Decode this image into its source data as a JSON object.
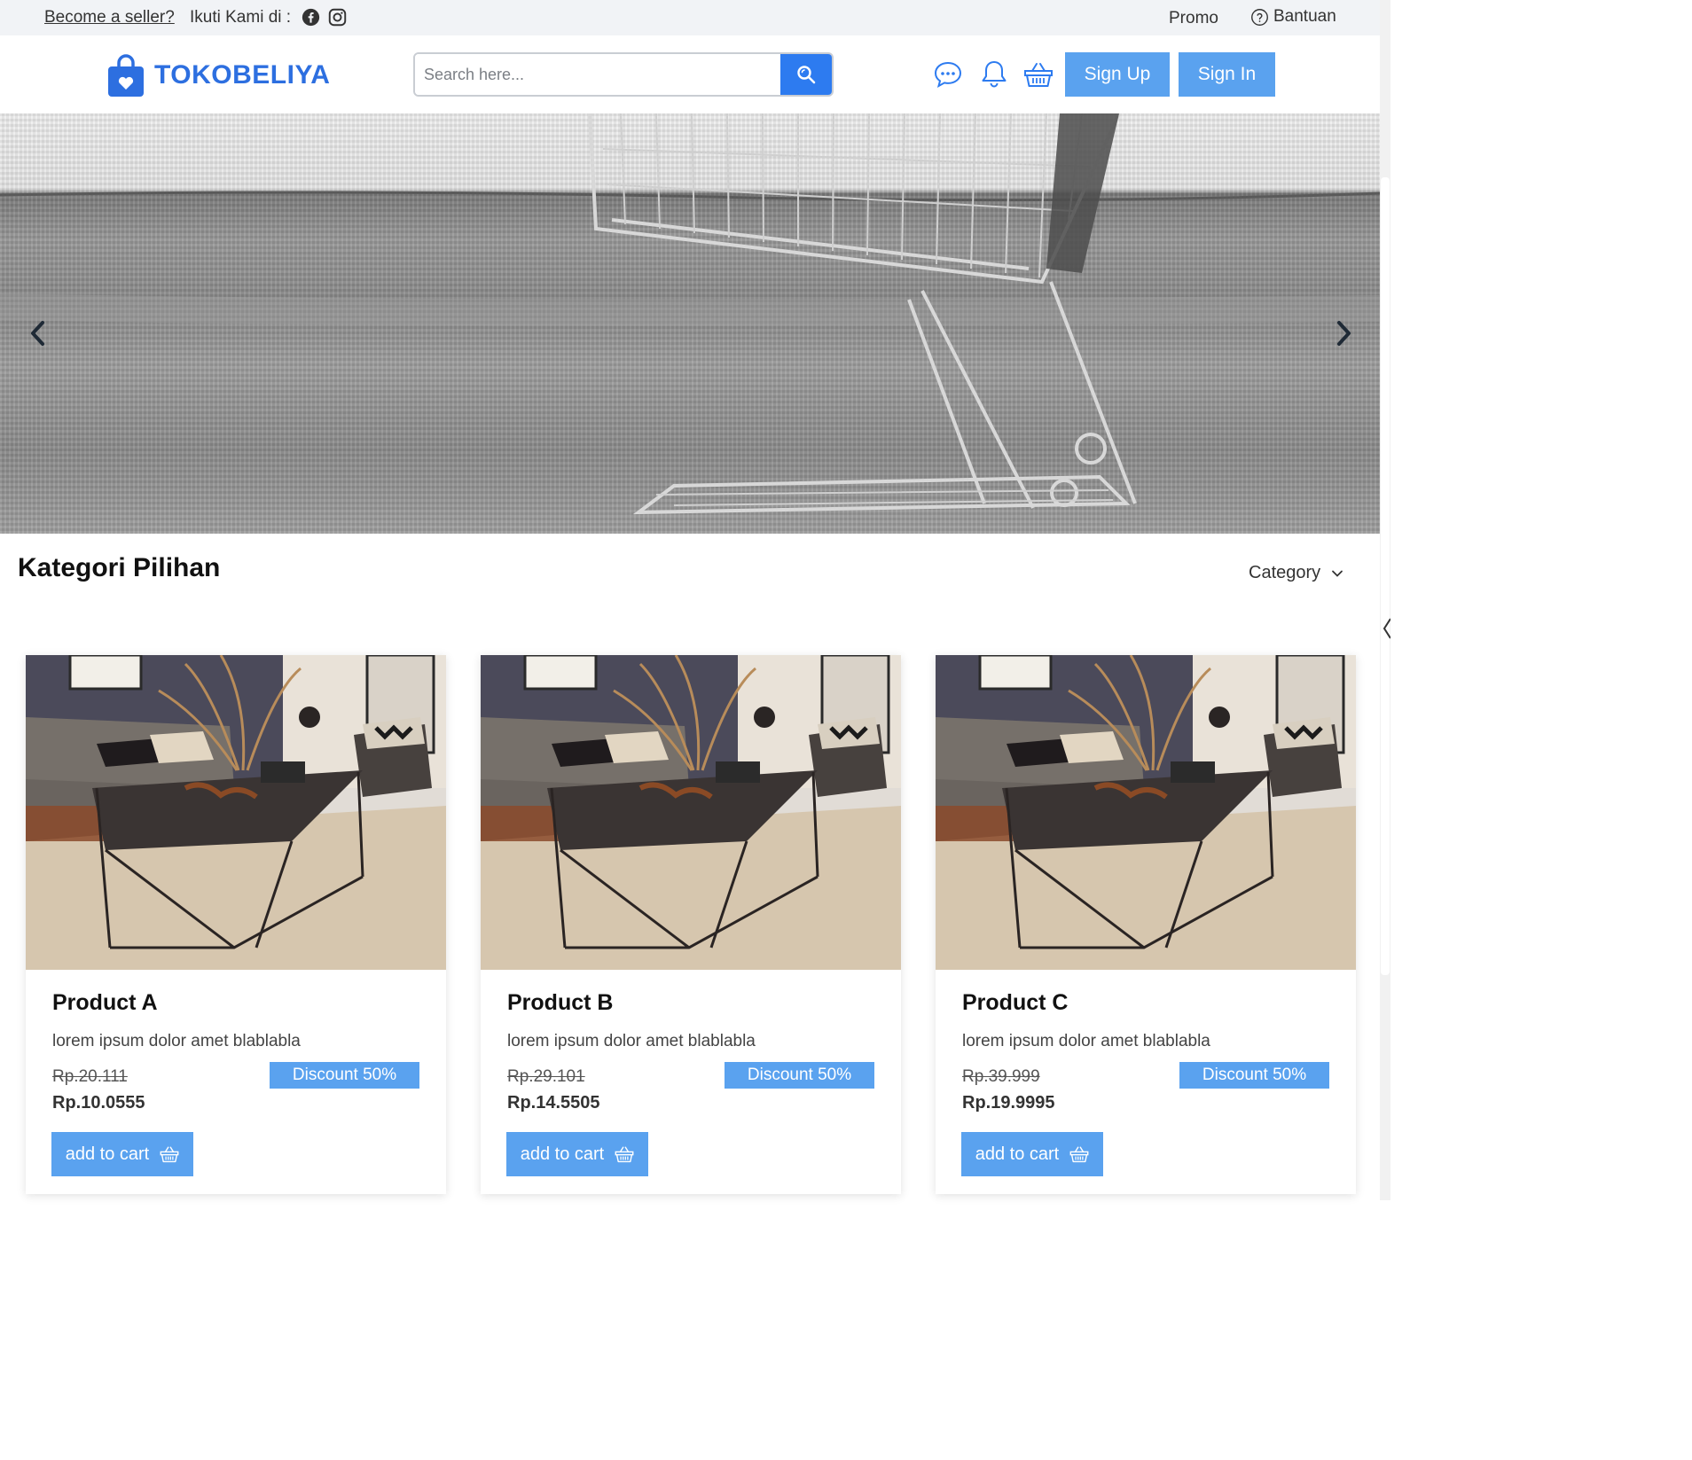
{
  "topbar": {
    "become_seller": "Become a seller?",
    "follow_label": "Ikuti Kami di :",
    "social_icons": [
      "facebook-icon",
      "instagram-icon"
    ],
    "promo": "Promo",
    "help": "Bantuan"
  },
  "header": {
    "brand": "TOKOBELIYA",
    "search_placeholder": "Search here...",
    "icons": [
      "chat-icon",
      "bell-icon",
      "basket-icon"
    ],
    "signup": "Sign Up",
    "signin": "Sign In"
  },
  "section": {
    "title": "Kategori Pilihan",
    "category_label": "Category"
  },
  "products": [
    {
      "title": "Product A",
      "desc": "lorem ipsum dolor amet blablabla",
      "old_price": "Rp.20.111",
      "new_price": "Rp.10.0555",
      "discount": "Discount 50%",
      "cart_label": "add to cart"
    },
    {
      "title": "Product B",
      "desc": "lorem ipsum dolor amet blablabla",
      "old_price": "Rp.29.101",
      "new_price": "Rp.14.5505",
      "discount": "Discount 50%",
      "cart_label": "add to cart"
    },
    {
      "title": "Product C",
      "desc": "lorem ipsum dolor amet blablabla",
      "old_price": "Rp.39.999",
      "new_price": "Rp.19.9995",
      "discount": "Discount 50%",
      "cart_label": "add to cart"
    }
  ],
  "colors": {
    "brand": "#2d6fe0",
    "button": "#5aa2ef",
    "search_button": "#2d7bf0",
    "topbar_bg": "#f1f3f6"
  }
}
